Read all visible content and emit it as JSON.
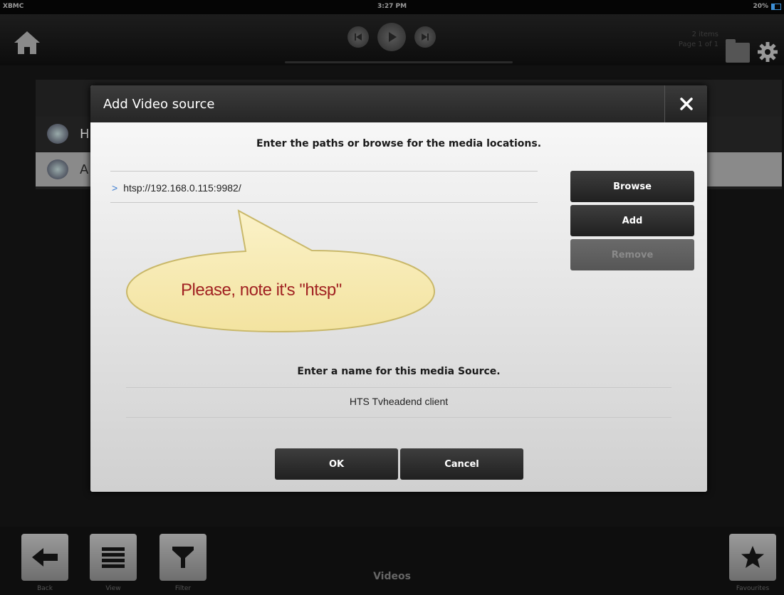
{
  "statusbar": {
    "app_name": "XBMC",
    "time": "3:27 PM",
    "battery": "20%"
  },
  "topbar": {
    "items_count": "2 items",
    "page_info": "Page 1 of 1"
  },
  "list": {
    "row1_letter": "H",
    "row2_letter": "A"
  },
  "dialog": {
    "title": "Add Video source",
    "paths_heading": "Enter the paths or browse for the media locations.",
    "path_value": "htsp://192.168.0.115:9982/",
    "browse_label": "Browse",
    "add_label": "Add",
    "remove_label": "Remove",
    "name_heading": "Enter a name for this media Source.",
    "name_value": "HTS Tvheadend client",
    "ok_label": "OK",
    "cancel_label": "Cancel"
  },
  "callout": {
    "text": "Please, note it's \"htsp\""
  },
  "bottombar": {
    "section_title": "Videos",
    "back_label": "Back",
    "view_label": "View",
    "filter_label": "Filter",
    "favourites_label": "Favourites"
  },
  "colors": {
    "accent": "#3a7bd0",
    "callout_text": "#a12222",
    "callout_fill": "#f7eab0"
  }
}
